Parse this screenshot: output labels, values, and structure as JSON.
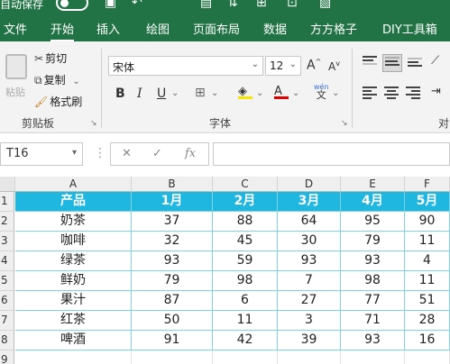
{
  "titlebar": {
    "autosave_label": "自动保存",
    "icons": [
      "save-icon",
      "undo-icon",
      "redo-icon",
      "print-preview-icon",
      "sort-icon",
      "format-painter-icon",
      "more-icon"
    ]
  },
  "tabs": [
    {
      "label": "文件",
      "active": false
    },
    {
      "label": "开始",
      "active": true
    },
    {
      "label": "插入",
      "active": false
    },
    {
      "label": "绘图",
      "active": false
    },
    {
      "label": "页面布局",
      "active": false
    },
    {
      "label": "数据",
      "active": false
    },
    {
      "label": "方方格子",
      "active": false
    },
    {
      "label": "DIY工具箱",
      "active": false
    }
  ],
  "ribbon": {
    "clipboard": {
      "paste_label": "粘贴",
      "cut_label": "剪切",
      "copy_label": "复制",
      "format_painter_label": "格式刷",
      "group_label": "剪贴板"
    },
    "font": {
      "font_name": "宋体",
      "font_size": "12",
      "bold": "B",
      "italic": "I",
      "underline": "U",
      "group_label": "字体",
      "wen_top": "wén",
      "wen_bottom": "文"
    },
    "alignment": {
      "group_label_partial": "对"
    }
  },
  "formula_bar": {
    "name_box": "T16",
    "cancel": "✕",
    "confirm": "✓",
    "fx": "fx",
    "value": ""
  },
  "colors": {
    "brand": "#217346",
    "header_fill": "#1fb6e0",
    "grid_border": "#7fd3e6"
  },
  "sheet": {
    "columns": [
      "A",
      "B",
      "C",
      "D",
      "E",
      "F"
    ],
    "rows": [
      "1",
      "2",
      "3",
      "4",
      "5",
      "6",
      "7",
      "8",
      "9"
    ],
    "header": [
      "产品",
      "1月",
      "2月",
      "3月",
      "4月",
      "5月"
    ],
    "data": [
      [
        "奶茶",
        "37",
        "88",
        "64",
        "95",
        "90"
      ],
      [
        "咖啡",
        "32",
        "45",
        "30",
        "79",
        "11"
      ],
      [
        "绿茶",
        "93",
        "59",
        "93",
        "93",
        "4"
      ],
      [
        "鲜奶",
        "79",
        "98",
        "7",
        "98",
        "11"
      ],
      [
        "果汁",
        "87",
        "6",
        "27",
        "77",
        "51"
      ],
      [
        "红茶",
        "50",
        "11",
        "3",
        "71",
        "28"
      ],
      [
        "啤酒",
        "91",
        "42",
        "39",
        "93",
        "16"
      ]
    ]
  }
}
